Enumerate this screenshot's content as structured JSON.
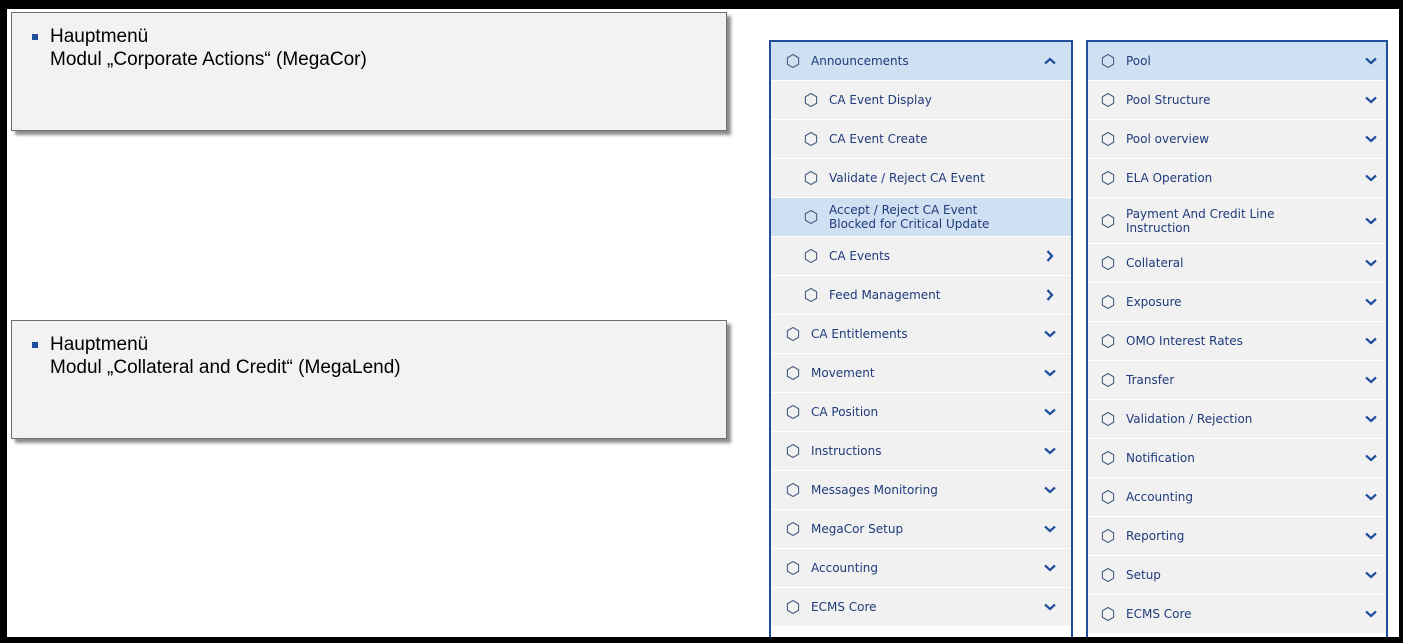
{
  "notes": [
    {
      "title": "Hauptmenü",
      "module": "Modul „Corporate Actions“ (MegaCor)"
    },
    {
      "title": "Hauptmenü",
      "module": "Modul „Collateral and Credit“ (MegaLend)"
    }
  ],
  "megacor_menu": [
    {
      "label": "Announcements",
      "level": "top",
      "chevron": "up",
      "active": true
    },
    {
      "label": "CA Event Display",
      "level": "sub",
      "chevron": "none"
    },
    {
      "label": "CA Event Create",
      "level": "sub",
      "chevron": "none"
    },
    {
      "label": "Validate / Reject CA Event",
      "level": "sub",
      "chevron": "none"
    },
    {
      "label": "Accept / Reject CA Event\nBlocked for Critical Update",
      "level": "sub",
      "chevron": "none",
      "active": true
    },
    {
      "label": "CA Events",
      "level": "sub",
      "chevron": "right"
    },
    {
      "label": "Feed Management",
      "level": "sub",
      "chevron": "right"
    },
    {
      "label": "CA Entitlements",
      "level": "top",
      "chevron": "down"
    },
    {
      "label": "Movement",
      "level": "top",
      "chevron": "down"
    },
    {
      "label": "CA Position",
      "level": "top",
      "chevron": "down"
    },
    {
      "label": "Instructions",
      "level": "top",
      "chevron": "down"
    },
    {
      "label": "Messages Monitoring",
      "level": "top",
      "chevron": "down"
    },
    {
      "label": "MegaCor Setup",
      "level": "top",
      "chevron": "down"
    },
    {
      "label": "Accounting",
      "level": "top",
      "chevron": "down"
    },
    {
      "label": "ECMS Core",
      "level": "top",
      "chevron": "down"
    }
  ],
  "megalend_menu": [
    {
      "label": "Pool",
      "chevron": "down",
      "active": true
    },
    {
      "label": "Pool Structure",
      "chevron": "down"
    },
    {
      "label": "Pool overview",
      "chevron": "down"
    },
    {
      "label": "ELA Operation",
      "chevron": "down"
    },
    {
      "label": "Payment And Credit Line\nInstruction",
      "chevron": "down",
      "tall": true
    },
    {
      "label": "Collateral",
      "chevron": "down"
    },
    {
      "label": "Exposure",
      "chevron": "down"
    },
    {
      "label": "OMO Interest Rates",
      "chevron": "down"
    },
    {
      "label": "Transfer",
      "chevron": "down"
    },
    {
      "label": "Validation / Rejection",
      "chevron": "down"
    },
    {
      "label": "Notification",
      "chevron": "down"
    },
    {
      "label": "Accounting",
      "chevron": "down"
    },
    {
      "label": "Reporting",
      "chevron": "down"
    },
    {
      "label": "Setup",
      "chevron": "down"
    },
    {
      "label": "ECMS Core",
      "chevron": "down"
    }
  ],
  "colors": {
    "accent": "#1f4e9c",
    "item_text": "#1f3b7a",
    "active_bg": "#cfe0f2",
    "item_bg": "#f1f1f1"
  }
}
